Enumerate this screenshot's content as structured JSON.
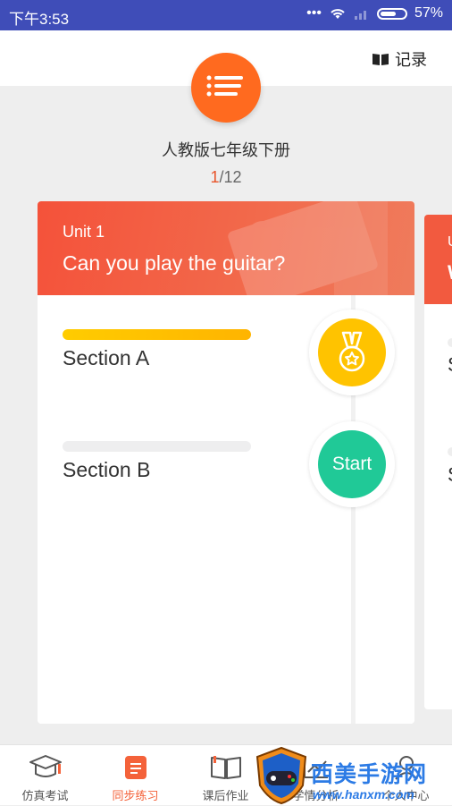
{
  "status_bar": {
    "time": "下午3:53",
    "battery": "57%"
  },
  "header": {
    "record_label": "记录"
  },
  "book": {
    "title": "人教版七年级下册",
    "page_current": "1",
    "page_total": "/12"
  },
  "unit_card": {
    "unit_label": "Unit 1",
    "unit_title": "Can you play the guitar?",
    "sections": [
      {
        "label": "Section A",
        "progress": 1.0,
        "status": "medal-icon"
      },
      {
        "label": "Section B",
        "progress": 0.0,
        "button_label": "Start"
      }
    ]
  },
  "next_card": {
    "unit_label_partial": "U",
    "title_partial": "W",
    "section_a_partial": "S",
    "section_b_partial": "S"
  },
  "tabs": [
    {
      "label": "仿真考试",
      "icon": "graduation-cap-icon"
    },
    {
      "label": "同步练习",
      "icon": "document-icon",
      "active": true
    },
    {
      "label": "课后作业",
      "icon": "book-icon"
    },
    {
      "label": "学情分析",
      "icon": "chart-icon"
    },
    {
      "label": "个人中心",
      "icon": "person-icon"
    }
  ],
  "watermark": {
    "title": "西美手游网",
    "url": "www.hanxm.com"
  },
  "colors": {
    "accent": "#f4623a",
    "status_bar": "#3f4db8",
    "medal": "#ffc300",
    "start": "#20c997"
  }
}
